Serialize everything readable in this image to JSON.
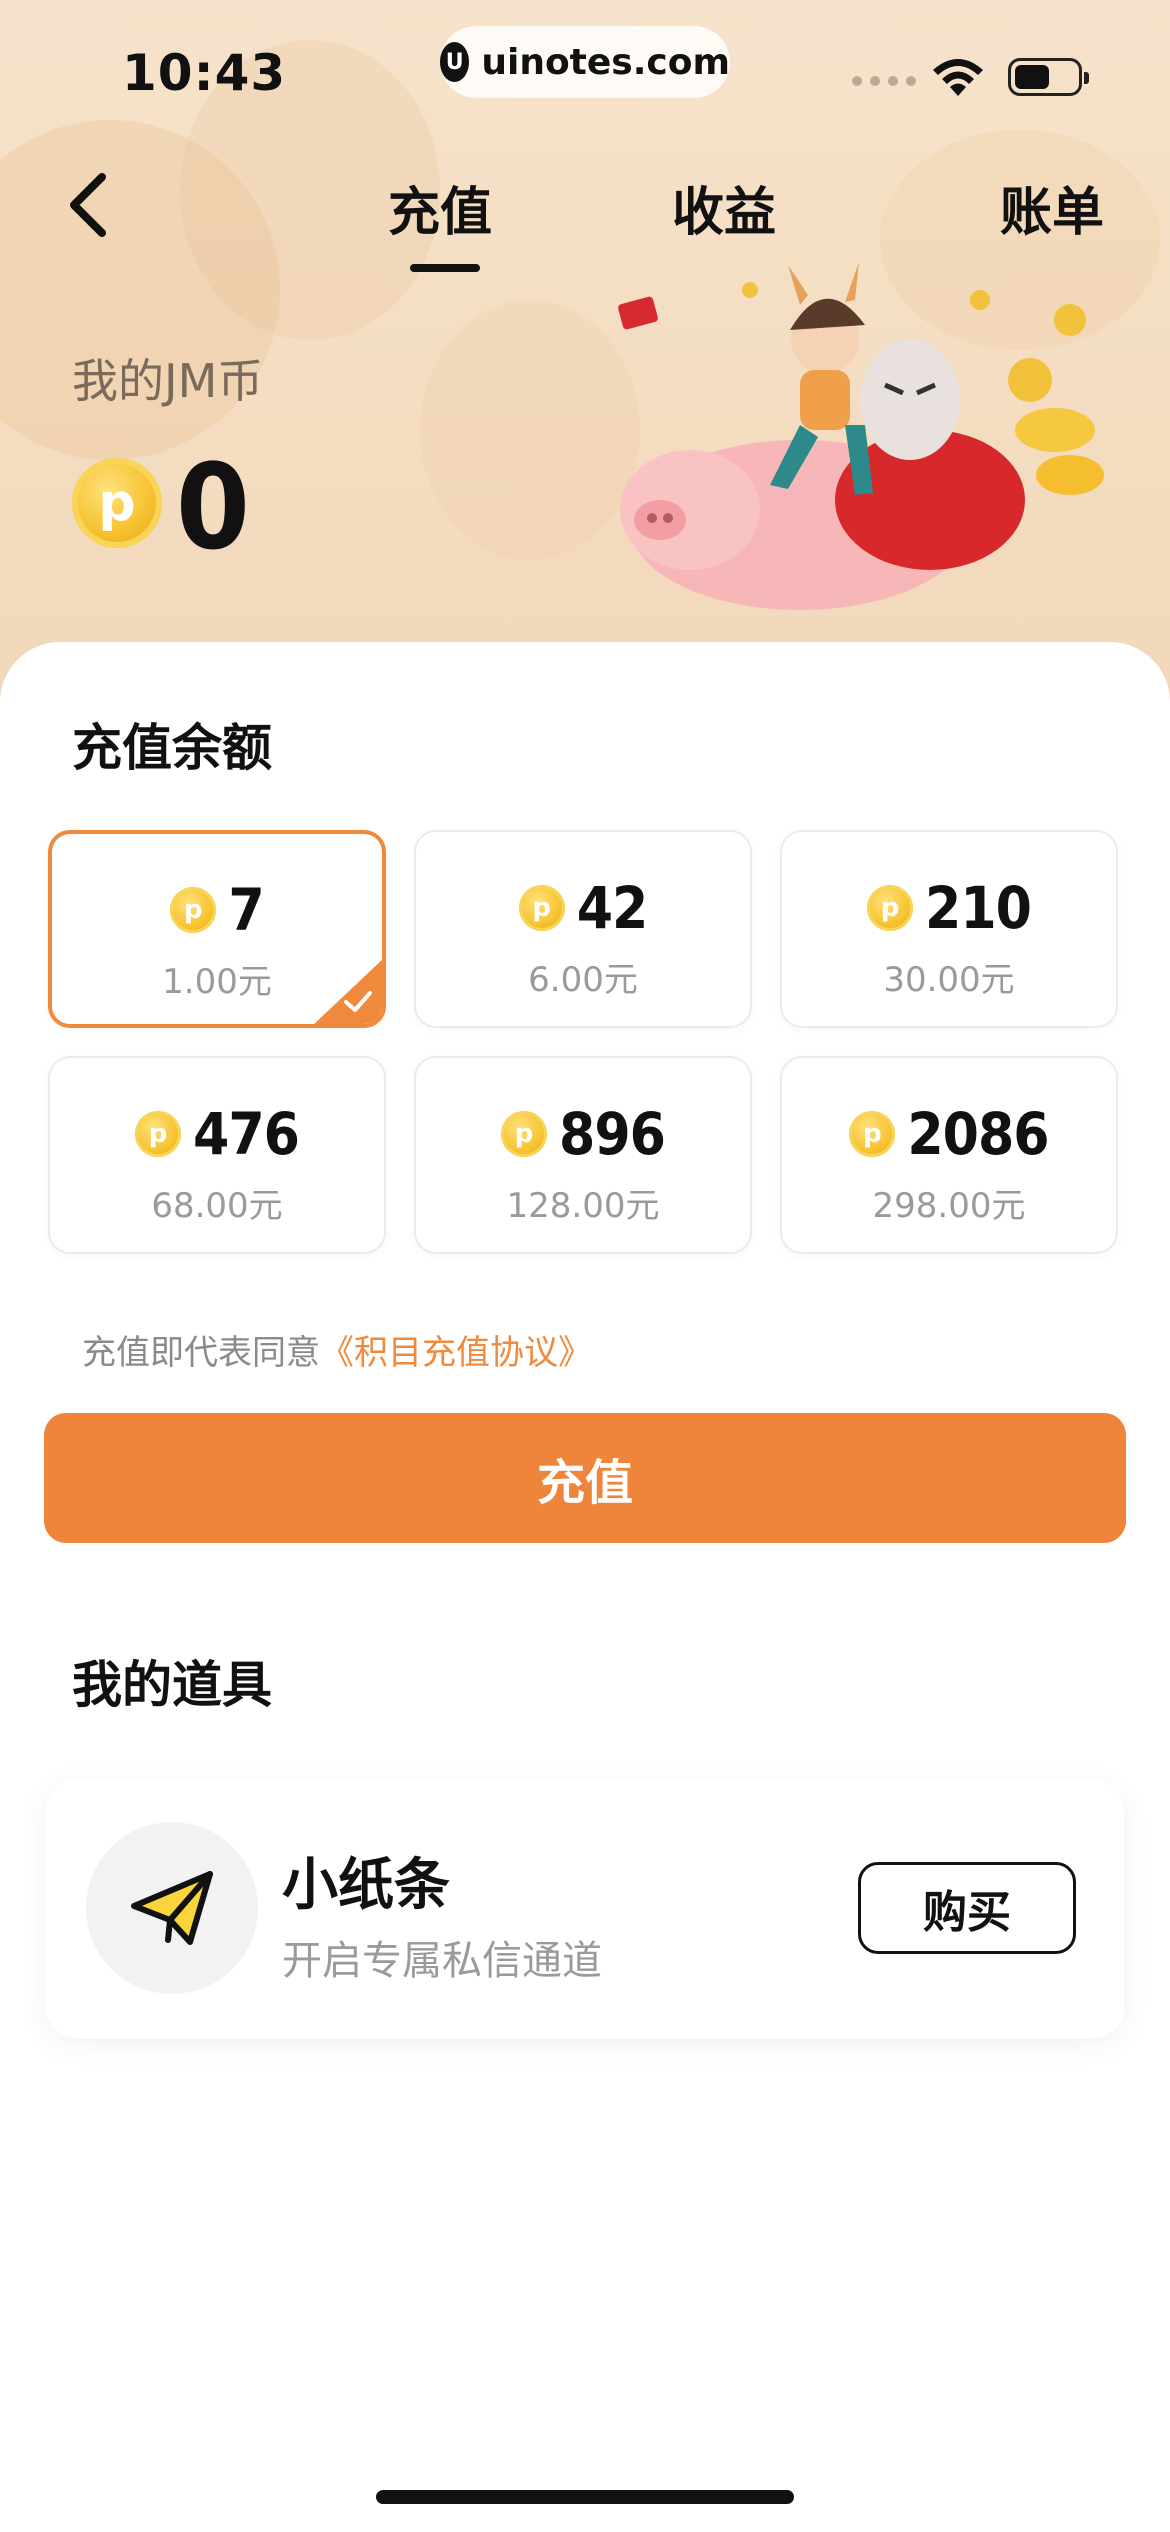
{
  "status_bar": {
    "time": "10:43",
    "url": "uinotes.com",
    "url_logo": "U"
  },
  "nav": {
    "tabs": [
      {
        "label": "充值",
        "active": true
      },
      {
        "label": "收益",
        "active": false
      },
      {
        "label": "账单",
        "active": false
      }
    ],
    "back_icon": "chevron-left-icon"
  },
  "balance": {
    "label": "我的JM币",
    "coin_symbol": "p",
    "value": "0"
  },
  "recharge": {
    "section_title": "充值余额",
    "packages": [
      {
        "coins": "7",
        "price": "1.00元",
        "selected": true
      },
      {
        "coins": "42",
        "price": "6.00元",
        "selected": false
      },
      {
        "coins": "210",
        "price": "30.00元",
        "selected": false
      },
      {
        "coins": "476",
        "price": "68.00元",
        "selected": false
      },
      {
        "coins": "896",
        "price": "128.00元",
        "selected": false
      },
      {
        "coins": "2086",
        "price": "298.00元",
        "selected": false
      }
    ],
    "agreement_prefix": "充值即代表同意",
    "agreement_link": "《积目充值协议》",
    "button_label": "充值"
  },
  "props": {
    "section_title": "我的道具",
    "items": [
      {
        "name": "小纸条",
        "description": "开启专属私信通道",
        "icon": "paper-plane-icon",
        "button_label": "购买"
      }
    ]
  },
  "colors": {
    "accent": "#ef853a",
    "hero_bg": "#f6e3cb",
    "coin": "#f6c12e"
  }
}
